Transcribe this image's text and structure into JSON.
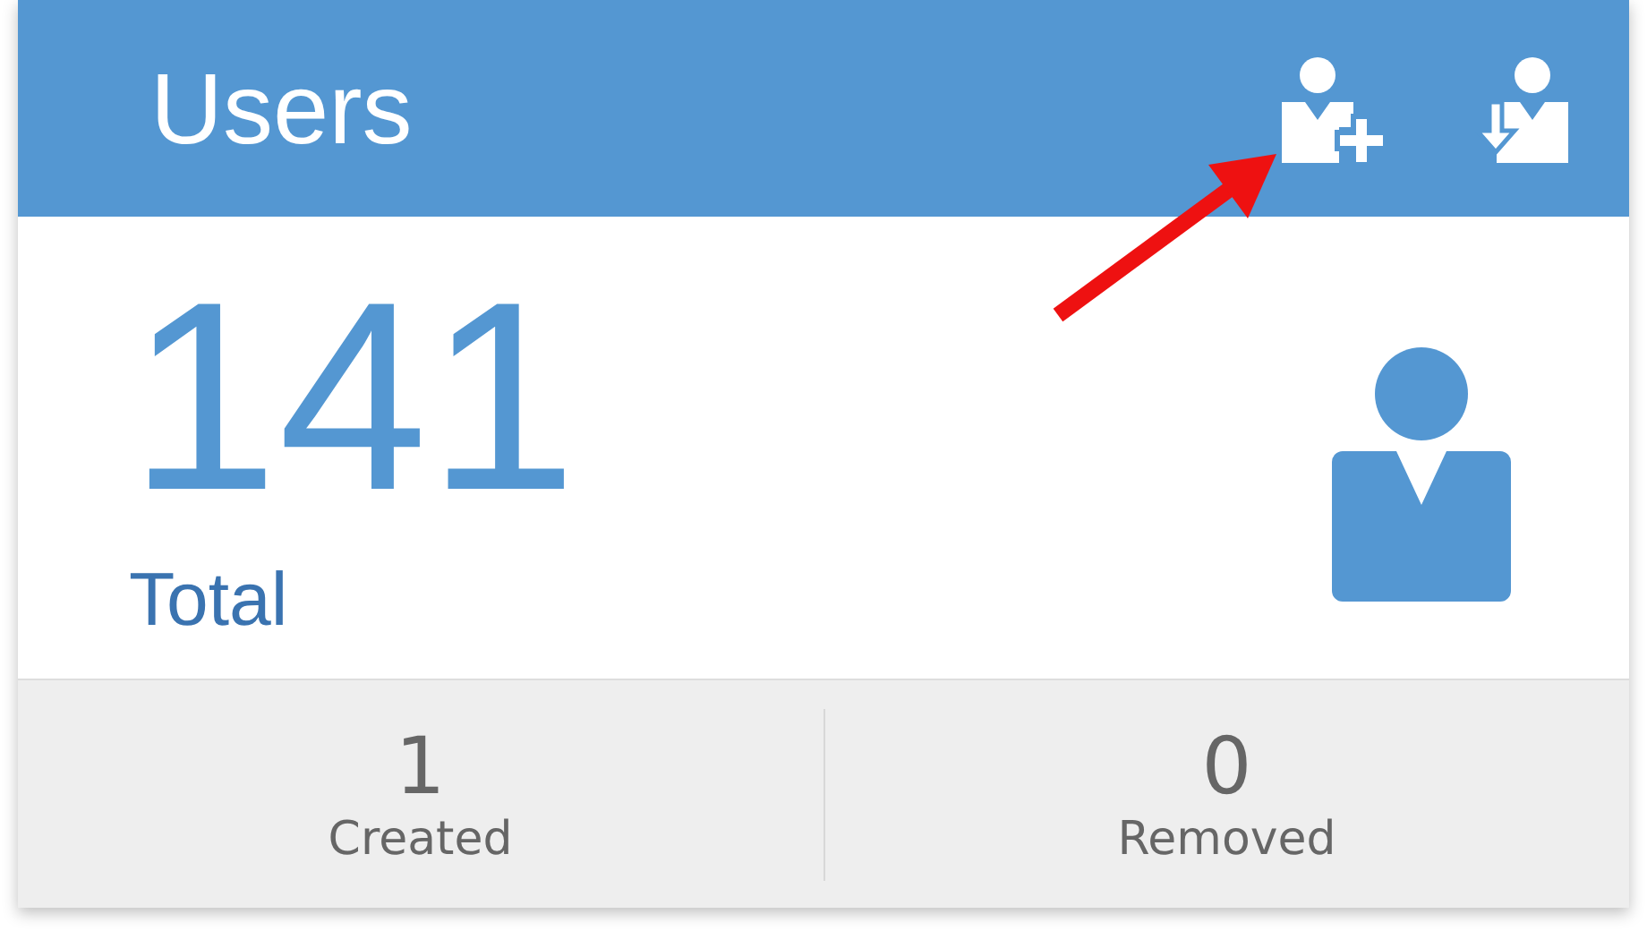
{
  "header": {
    "title": "Users"
  },
  "summary": {
    "count": "141",
    "label": "Total"
  },
  "stats": [
    {
      "value": "1",
      "label": "Created"
    },
    {
      "value": "0",
      "label": "Removed"
    }
  ]
}
